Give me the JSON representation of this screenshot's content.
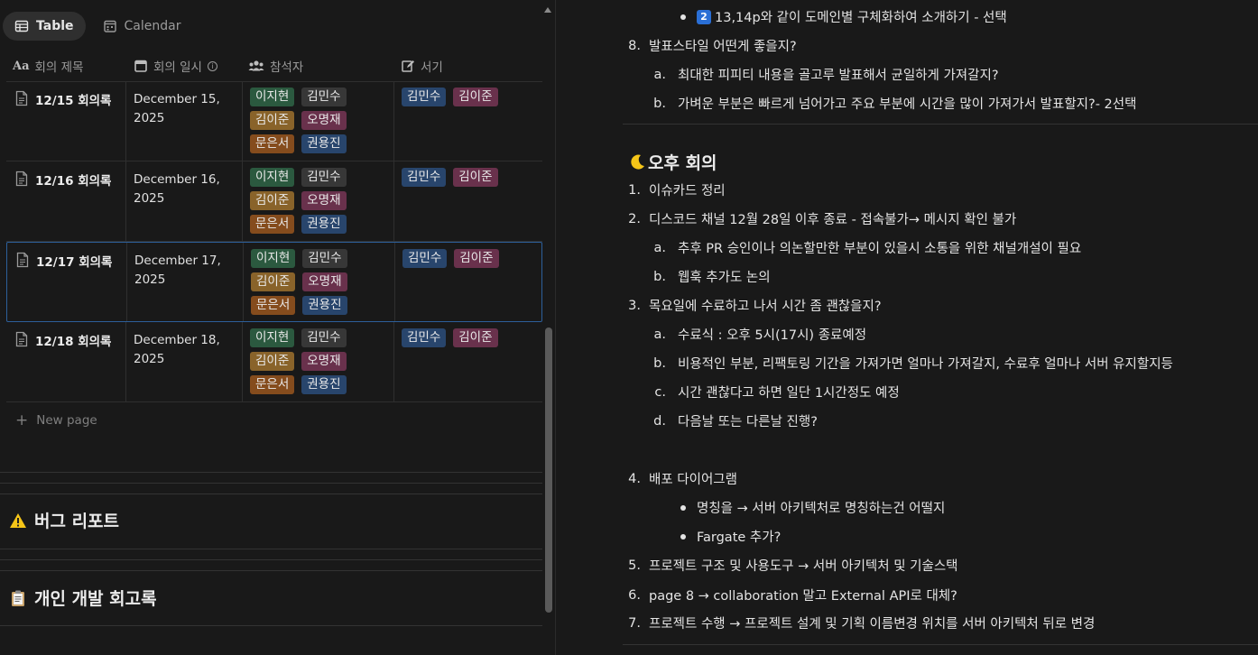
{
  "left": {
    "tabs": [
      {
        "label": "Table",
        "icon": "table-icon"
      },
      {
        "label": "Calendar",
        "icon": "calendar-icon"
      }
    ],
    "columns": [
      {
        "label": "회의 제목",
        "icon": "text-property-icon"
      },
      {
        "label": "회의 일시",
        "icon": "date-property-icon"
      },
      {
        "label": "참석자",
        "icon": "people-property-icon"
      },
      {
        "label": "서기",
        "icon": "edit-property-icon"
      }
    ],
    "rows": [
      {
        "title": "12/15 회의록",
        "date_line1": "December 15,",
        "date_line2": "2025",
        "attendees": [
          "이지현",
          "김민수",
          "김이준",
          "오명재",
          "문은서",
          "권용진"
        ],
        "writers": [
          "김민수",
          "김이준"
        ]
      },
      {
        "title": "12/16 회의록",
        "date_line1": "December 16,",
        "date_line2": "2025",
        "attendees": [
          "이지현",
          "김민수",
          "김이준",
          "오명재",
          "문은서",
          "권용진"
        ],
        "writers": [
          "김민수",
          "김이준"
        ]
      },
      {
        "title": "12/17 회의록",
        "date_line1": "December 17,",
        "date_line2": "2025",
        "attendees": [
          "이지현",
          "김민수",
          "김이준",
          "오명재",
          "문은서",
          "권용진"
        ],
        "writers": [
          "김민수",
          "김이준"
        ]
      },
      {
        "title": "12/18 회의록",
        "date_line1": "December 18,",
        "date_line2": "2025",
        "attendees": [
          "이지현",
          "김민수",
          "김이준",
          "오명재",
          "문은서",
          "권용진"
        ],
        "writers": [
          "김민수",
          "김이준"
        ]
      }
    ],
    "new_page": "New page",
    "sections": [
      {
        "icon": "warning-icon",
        "label": "버그 리포트"
      },
      {
        "icon": "clipboard-icon",
        "label": "개인 개발 회고록"
      }
    ]
  },
  "tag_colors": {
    "이지현": "#2b593f",
    "김민수": "#373737",
    "김이준": "#89632a",
    "오명재": "#69314c",
    "문은서": "#854c1d",
    "권용진": "#28456c"
  },
  "writer_colors": {
    "김민수": "#28456c",
    "김이준": "#69314c"
  },
  "right": {
    "top_bullet": {
      "badge": "2",
      "text": "13,14p와 같이 도메인별 구체화하여 소개하기 - 선택"
    },
    "item8": {
      "num": "8.",
      "text": "발표스타일 어떤게 좋을지?"
    },
    "item8a": {
      "num": "a.",
      "text": "최대한 피피티 내용을 골고루 발표해서 균일하게 가져갈지?"
    },
    "item8b": {
      "num": "b.",
      "text": "가벼운 부분은 빠르게 넘어가고 주요 부분에 시간을 많이 가져가서 발표할지?- 2선택"
    },
    "heading": {
      "icon": "moon-icon",
      "text": "오후 회의"
    },
    "items": [
      {
        "num": "1.",
        "text": "이슈카드 정리"
      },
      {
        "num": "2.",
        "text": "디스코드 채널 12월 28일 이후 종료 - 접속불가→ 메시지 확인 불가"
      },
      {
        "num": "a.",
        "text": "추후 PR 승인이나 의논할만한 부분이 있을시 소통을 위한 채널개설이 필요"
      },
      {
        "num": "b.",
        "text": "웹훅 추가도 논의"
      },
      {
        "num": "3.",
        "text": "목요일에 수료하고 나서 시간 좀 괜찮을지?"
      },
      {
        "num": "a.",
        "text": "수료식 : 오후 5시(17시) 종료예정"
      },
      {
        "num": "b.",
        "text": "비용적인 부분, 리팩토링 기간을 가져가면 얼마나 가져갈지, 수료후 얼마나 서버 유지할지등"
      },
      {
        "num": "c.",
        "text": "시간 괜찮다고 하면 일단 1시간정도 예정"
      },
      {
        "num": "d.",
        "text": "다음날 또는 다른날 진행?"
      },
      {
        "num": "4.",
        "text": "배포 다이어그램"
      },
      {
        "num": "•",
        "text": "명칭을 → 서버 아키텍처로 명칭하는건 어떨지"
      },
      {
        "num": "•",
        "text": " Fargate 추가?"
      },
      {
        "num": "5.",
        "text": "프로젝트 구조 및 사용도구 → 서버 아키텍처 및 기술스택"
      },
      {
        "num": "6.",
        "text": "page 8 → collaboration 말고 External API로 대체?"
      },
      {
        "num": "7.",
        "text": "프로젝트 수행 → 프로젝트 설계 및 기획 이름변경 위치를 서버 아키텍처 뒤로 변경"
      }
    ]
  }
}
